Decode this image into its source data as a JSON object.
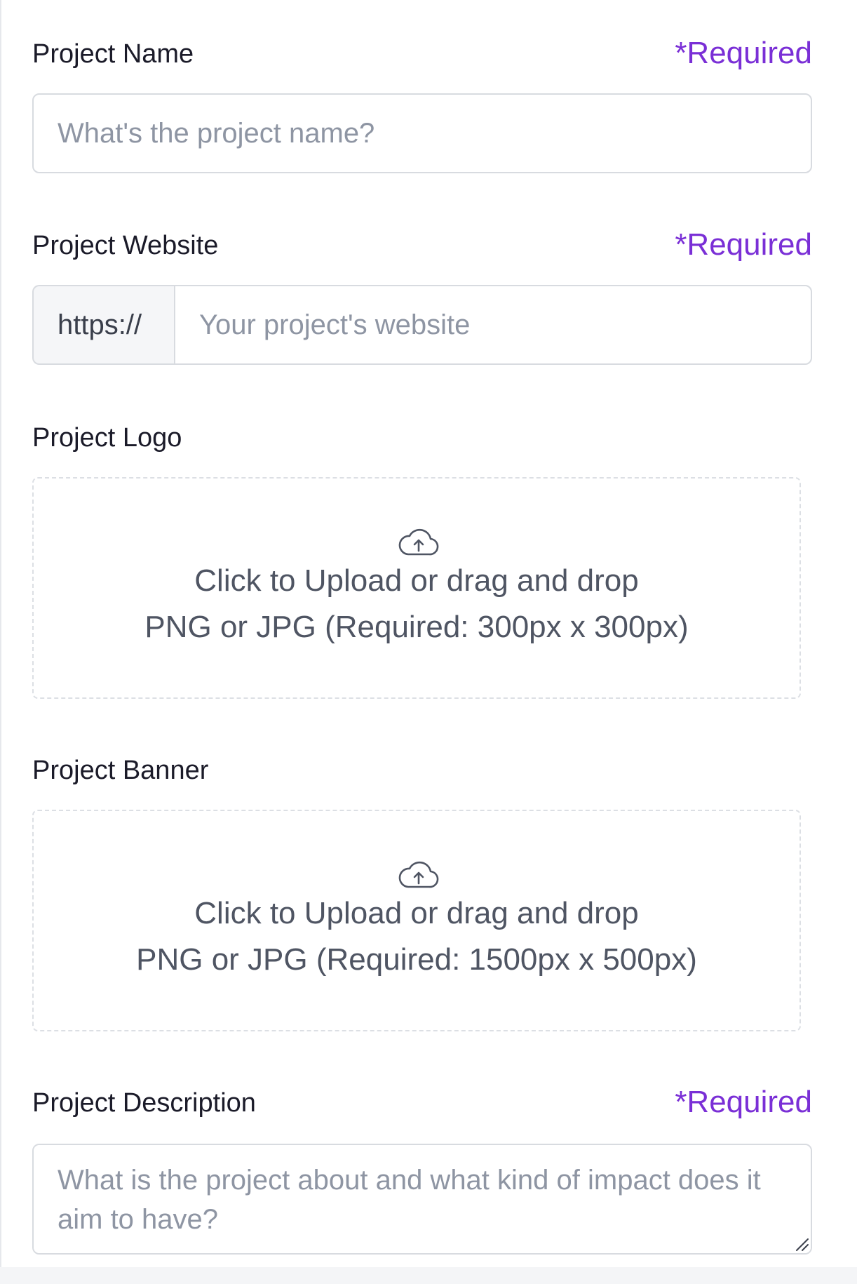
{
  "project_name": {
    "label": "Project Name",
    "required": "*Required",
    "placeholder": "What's the project name?",
    "value": ""
  },
  "project_website": {
    "label": "Project Website",
    "required": "*Required",
    "prefix": "https://",
    "placeholder": "Your project's website",
    "value": ""
  },
  "project_logo": {
    "label": "Project Logo",
    "icon": "cloud-upload-icon",
    "upload_text": "Click to Upload or drag and drop",
    "hint": "PNG or JPG (Required: 300px x 300px)"
  },
  "project_banner": {
    "label": "Project Banner",
    "icon": "cloud-upload-icon",
    "upload_text": "Click to Upload or drag and drop",
    "hint": "PNG or JPG (Required: 1500px x 500px)"
  },
  "project_description": {
    "label": "Project Description",
    "required": "*Required",
    "placeholder": "What is the project about and what kind of impact does it aim to have?",
    "value": ""
  },
  "colors": {
    "accent": "#7a2fd6",
    "label": "#1b1b29",
    "placeholder": "#8e95a3",
    "border": "#d8dbe0"
  }
}
